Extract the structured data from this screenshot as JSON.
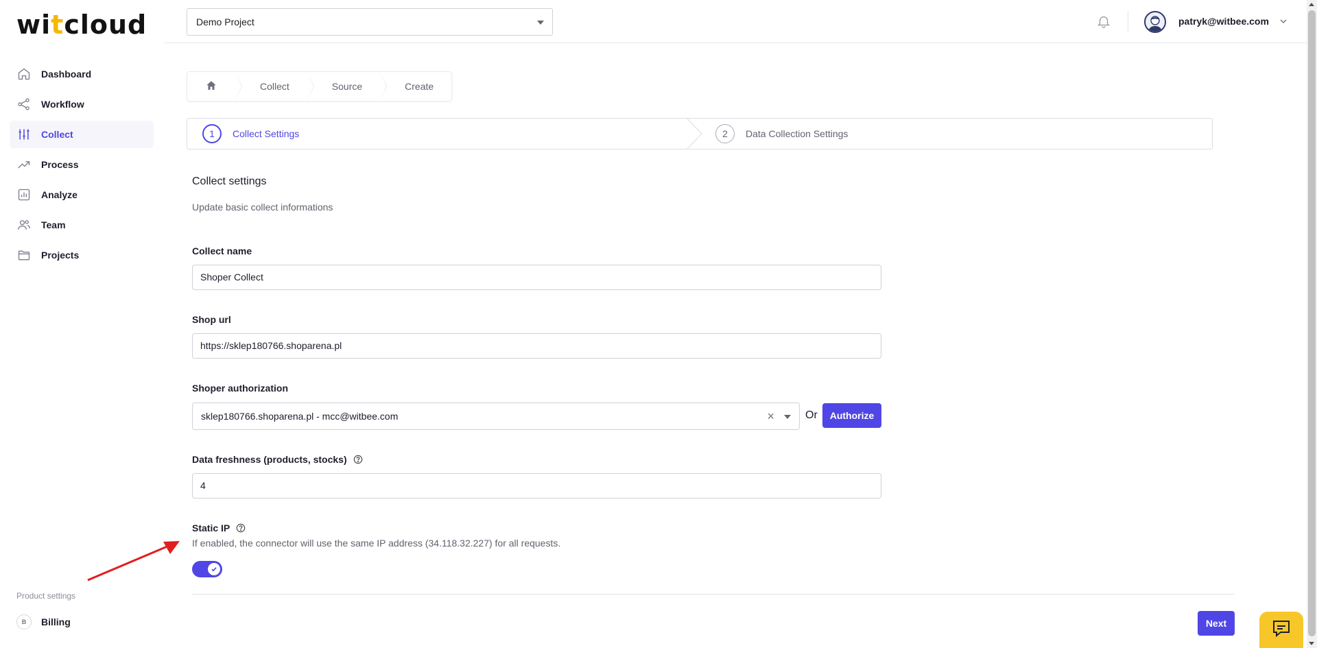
{
  "app": {
    "logo_pre": "wi",
    "logo_t": "t",
    "logo_post": "cloud"
  },
  "sidebar": {
    "items": [
      {
        "label": "Dashboard",
        "icon": "home-icon"
      },
      {
        "label": "Workflow",
        "icon": "share-icon"
      },
      {
        "label": "Collect",
        "icon": "sliders-icon",
        "active": true
      },
      {
        "label": "Process",
        "icon": "trending-up-icon"
      },
      {
        "label": "Analyze",
        "icon": "bar-chart-icon"
      },
      {
        "label": "Team",
        "icon": "users-icon"
      },
      {
        "label": "Projects",
        "icon": "folder-icon"
      }
    ],
    "product_settings_label": "Product settings",
    "billing_badge": "B",
    "billing_label": "Billing"
  },
  "topbar": {
    "project": "Demo Project",
    "user_email": "patryk@witbee.com"
  },
  "breadcrumb": {
    "items": [
      "Collect",
      "Source",
      "Create"
    ]
  },
  "steps": [
    {
      "num": "1",
      "label": "Collect Settings",
      "active": true
    },
    {
      "num": "2",
      "label": "Data Collection Settings",
      "active": false
    }
  ],
  "form": {
    "title": "Collect settings",
    "subtitle": "Update basic collect informations",
    "collect_name_label": "Collect name",
    "collect_name_value": "Shoper Collect",
    "shop_url_label": "Shop url",
    "shop_url_value": "https://sklep180766.shoparena.pl",
    "auth_label": "Shoper authorization",
    "auth_value": "sklep180766.shoparena.pl - mcc@witbee.com",
    "or_text": "Or",
    "authorize_label": "Authorize",
    "freshness_label": "Data freshness (products, stocks)",
    "freshness_value": "4",
    "static_ip_label": "Static IP",
    "static_ip_desc": "If enabled, the connector will use the same IP address (34.118.32.227) for all requests.",
    "static_ip_enabled": true,
    "next_label": "Next"
  },
  "colors": {
    "accent": "#4f46e5",
    "chat_widget": "#f7c72a",
    "annotation_arrow": "#e11d1d"
  }
}
